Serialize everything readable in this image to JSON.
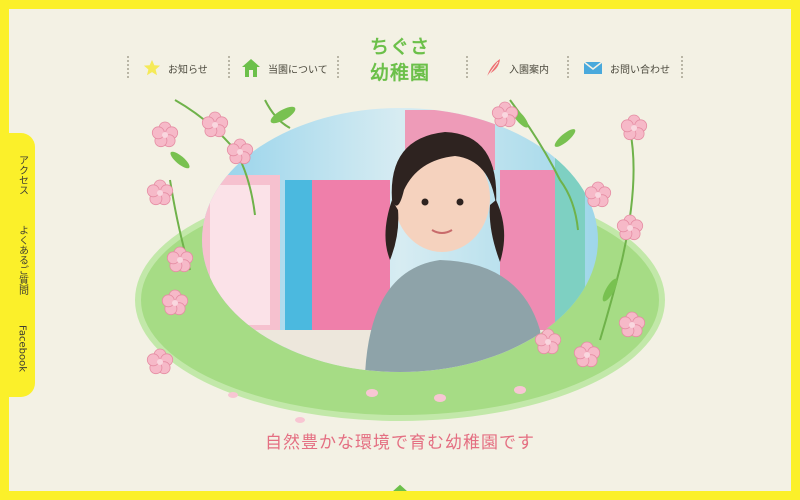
{
  "site": {
    "logo_line1": "ちぐさ",
    "logo_line2": "幼稚園",
    "tagline": "自然豊かな環境で育む幼稚園です"
  },
  "nav": {
    "items": [
      {
        "label": "お知らせ",
        "icon": "star-icon"
      },
      {
        "label": "当園について",
        "icon": "house-icon"
      },
      {
        "label": "入園案内",
        "icon": "feather-icon"
      },
      {
        "label": "お問い合わせ",
        "icon": "mail-icon"
      }
    ]
  },
  "side": {
    "items": [
      {
        "label": "アクセス"
      },
      {
        "label": "よくあるご質問"
      },
      {
        "label": "Facebook"
      }
    ]
  },
  "colors": {
    "frame": "#fbf02a",
    "accent_green": "#6cc04a",
    "pink": "#e46f82",
    "background": "#f3f1e4"
  }
}
